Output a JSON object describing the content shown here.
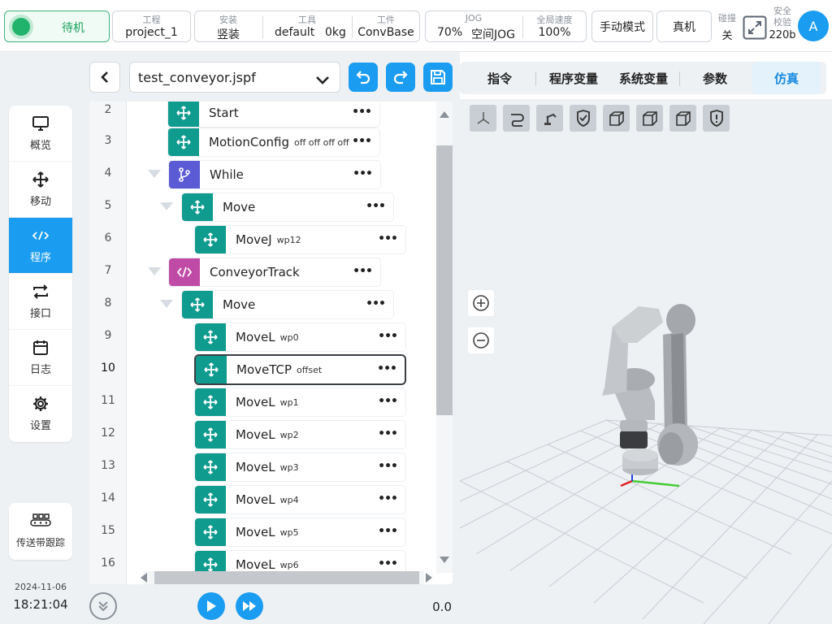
{
  "status": {
    "label": "待机",
    "color": "#21b36b"
  },
  "topbar": {
    "project": {
      "label": "工程",
      "value": "project_1"
    },
    "install": {
      "label": "安装",
      "value": "竖装"
    },
    "tool": {
      "label": "工具",
      "value": "default",
      "weight": "0kg"
    },
    "workpiece": {
      "label": "工件",
      "value": "ConvBase"
    },
    "jog": {
      "label": "JOG",
      "percent": "70%",
      "mode": "空间JOG"
    },
    "global_speed": {
      "label": "全局速度",
      "value": "100%"
    },
    "manual_mode": "手动模式",
    "real_robot": "真机",
    "collision": {
      "label": "碰撞",
      "value": "关"
    },
    "safety": {
      "label_line1": "安全",
      "label_line2": "校验",
      "value": "220b"
    },
    "avatar_letter": "A"
  },
  "nav": {
    "items": [
      {
        "label": "概览",
        "icon": "monitor-icon"
      },
      {
        "label": "移动",
        "icon": "move-icon"
      },
      {
        "label": "程序",
        "icon": "code-icon",
        "active": true
      },
      {
        "label": "接口",
        "icon": "interface-icon"
      },
      {
        "label": "日志",
        "icon": "calendar-icon"
      },
      {
        "label": "设置",
        "icon": "gear-icon"
      }
    ],
    "conveyor": "传送带跟踪",
    "date": "2024-11-06",
    "time": "18:21:04"
  },
  "program": {
    "filename": "test_conveyor.jspf",
    "lines": [
      {
        "no": "2",
        "label": "Start",
        "arg": "",
        "kind": "teal"
      },
      {
        "no": "3",
        "label": "MotionConfig",
        "arg": "off off off off",
        "kind": "teal"
      },
      {
        "no": "4",
        "label": "While",
        "arg": "",
        "kind": "purple"
      },
      {
        "no": "5",
        "label": "Move",
        "arg": "",
        "kind": "teal"
      },
      {
        "no": "6",
        "label": "MoveJ",
        "arg": "wp12",
        "kind": "teal"
      },
      {
        "no": "7",
        "label": "ConveyorTrack",
        "arg": "",
        "kind": "pink"
      },
      {
        "no": "8",
        "label": "Move",
        "arg": "",
        "kind": "teal"
      },
      {
        "no": "9",
        "label": "MoveL",
        "arg": "wp0",
        "kind": "teal"
      },
      {
        "no": "10",
        "label": "MoveTCP",
        "arg": "offset",
        "kind": "teal",
        "selected": true
      },
      {
        "no": "11",
        "label": "MoveL",
        "arg": "wp1",
        "kind": "teal"
      },
      {
        "no": "12",
        "label": "MoveL",
        "arg": "wp2",
        "kind": "teal"
      },
      {
        "no": "13",
        "label": "MoveL",
        "arg": "wp3",
        "kind": "teal"
      },
      {
        "no": "14",
        "label": "MoveL",
        "arg": "wp4",
        "kind": "teal"
      },
      {
        "no": "15",
        "label": "MoveL",
        "arg": "wp5",
        "kind": "teal"
      },
      {
        "no": "16",
        "label": "MoveL",
        "arg": "wp6",
        "kind": "teal"
      }
    ],
    "speed_value": "0.0"
  },
  "tabs": [
    {
      "label": "指令"
    },
    {
      "label": "程序变量"
    },
    {
      "label": "系统变量"
    },
    {
      "label": "参数"
    },
    {
      "label": "仿真",
      "active": true
    }
  ],
  "colors": {
    "accent": "#1a9cf0",
    "teal": "#0f9b8e",
    "purple": "#5b5bd6",
    "pink": "#c04ba6"
  }
}
